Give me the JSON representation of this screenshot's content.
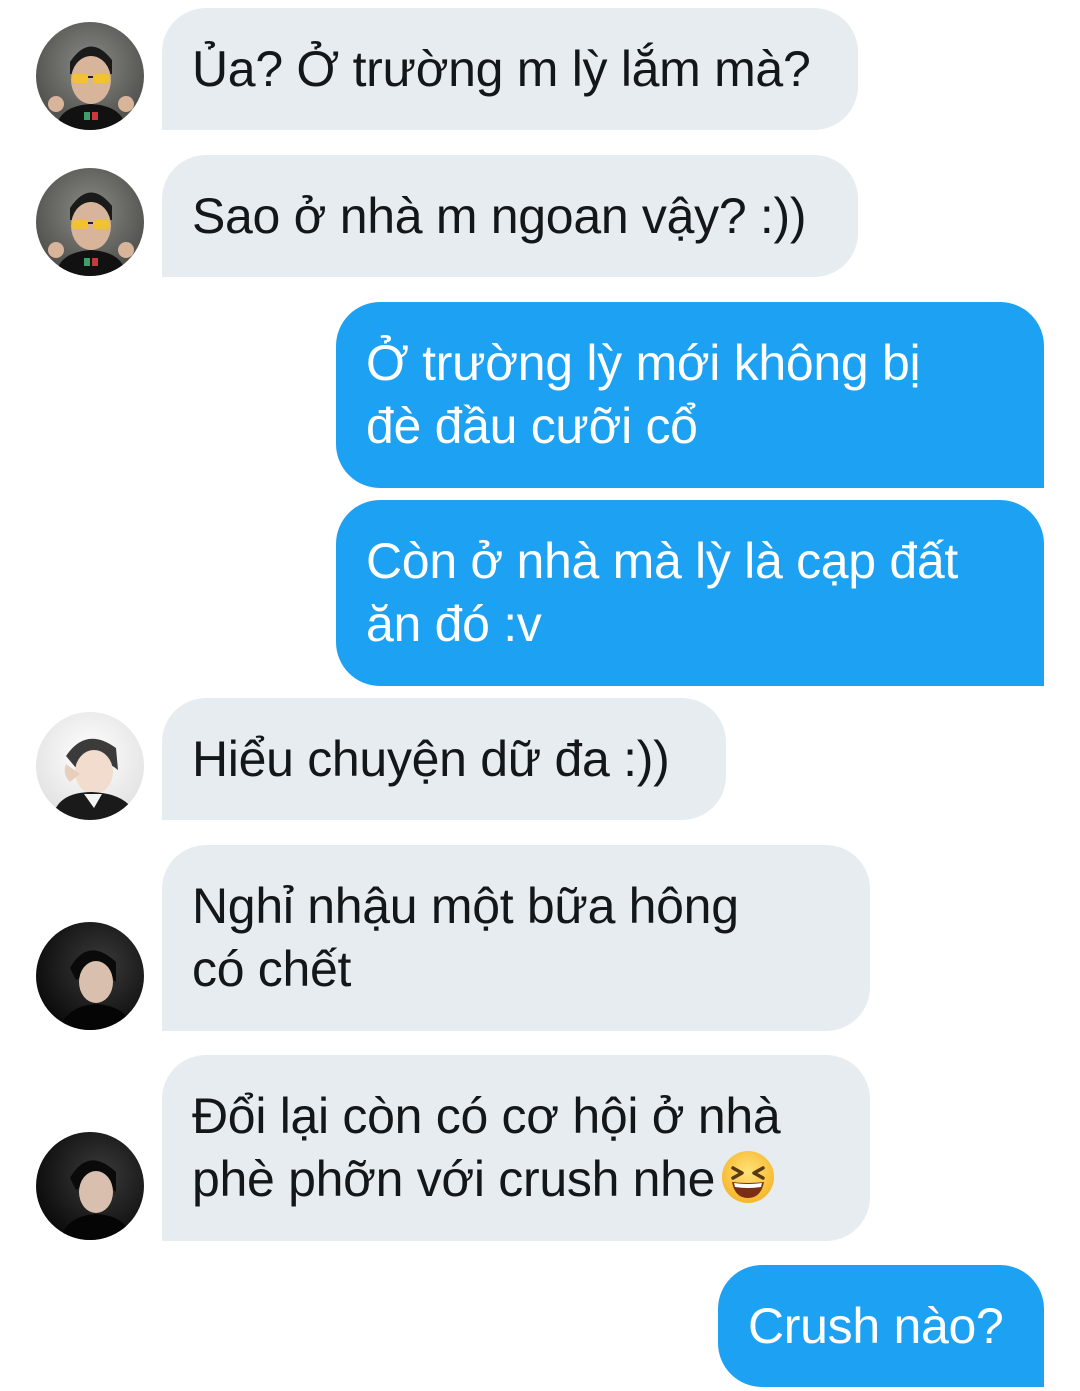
{
  "conversation": {
    "messages": [
      {
        "id": "m1",
        "direction": "incoming",
        "text": "Ủa? Ở trường m lỳ lắm mà?",
        "avatar_icon": "avatar-user-a-icon"
      },
      {
        "id": "m2",
        "direction": "incoming",
        "text": "Sao ở nhà m ngoan vậy? :))",
        "avatar_icon": "avatar-user-a-icon"
      },
      {
        "id": "m3",
        "direction": "outgoing",
        "text": "Ở trường lỳ mới không bị\nđè đầu cưỡi cổ"
      },
      {
        "id": "m4",
        "direction": "outgoing",
        "text": "Còn ở nhà mà lỳ là cạp đất\năn đó :v"
      },
      {
        "id": "m5",
        "direction": "incoming",
        "text": "Hiểu chuyện dữ đa :))",
        "avatar_icon": "avatar-user-b-icon"
      },
      {
        "id": "m6",
        "direction": "incoming",
        "text": "Nghỉ nhậu một bữa hông\ncó chết",
        "avatar_icon": "avatar-user-c-icon"
      },
      {
        "id": "m7",
        "direction": "incoming",
        "text": "Đổi lại còn có cơ hội ở nhà\nphè phỡn với crush nhe",
        "emoji": "laughing-face-emoji",
        "avatar_icon": "avatar-user-c-icon"
      },
      {
        "id": "m8",
        "direction": "outgoing",
        "text": "Crush nào?"
      }
    ]
  },
  "colors": {
    "incoming_bubble": "#e6ecf0",
    "incoming_text": "#14171a",
    "outgoing_bubble": "#1da1f2",
    "outgoing_text": "#ffffff",
    "background": "#ffffff"
  }
}
